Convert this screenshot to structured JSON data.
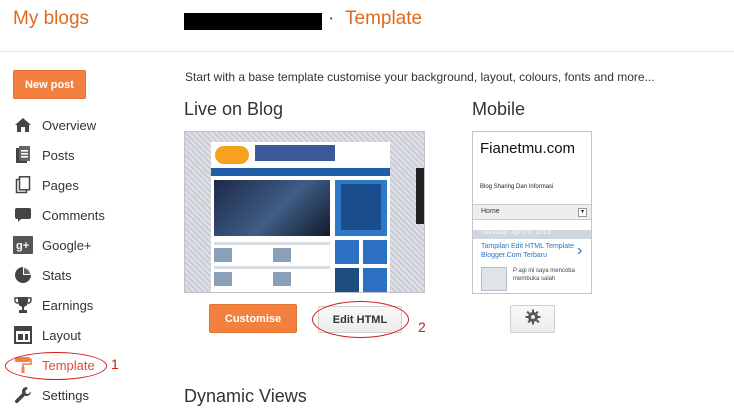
{
  "header": {
    "brand": "My blogs",
    "separator": "·",
    "page_title": "Template"
  },
  "sidebar": {
    "new_post_label": "New post",
    "items": [
      {
        "label": "Overview",
        "icon": "home-icon"
      },
      {
        "label": "Posts",
        "icon": "posts-icon"
      },
      {
        "label": "Pages",
        "icon": "pages-icon"
      },
      {
        "label": "Comments",
        "icon": "comment-icon"
      },
      {
        "label": "Google+",
        "icon": "google-plus-icon"
      },
      {
        "label": "Stats",
        "icon": "pie-chart-icon"
      },
      {
        "label": "Earnings",
        "icon": "trophy-icon"
      },
      {
        "label": "Layout",
        "icon": "layout-icon"
      },
      {
        "label": "Template",
        "icon": "paint-roller-icon",
        "active": true
      },
      {
        "label": "Settings",
        "icon": "wrench-icon"
      }
    ]
  },
  "annotations": {
    "marker_1": "1",
    "marker_2": "2",
    "color": "#d31a1a"
  },
  "main": {
    "intro_text": "Start with a base template customise your background, layout, colours, fonts and more...",
    "live_heading": "Live on Blog",
    "mobile_heading": "Mobile",
    "dynamic_heading": "Dynamic Views",
    "customise_label": "Customise",
    "edit_html_label": "Edit HTML"
  },
  "mobile_preview": {
    "site_title": "Fianetmu.com",
    "tagline": "Blog Sharing Dan Informasi",
    "menu_label": "Home",
    "date": "Tuesday, April 9, 2013",
    "post_title": "Tampilan Edit HTML Template Blogger.Com Terbaru",
    "excerpt": "P agi ini saya mencoba membuka salah"
  },
  "colors": {
    "accent": "#dd6b1f",
    "button_orange": "#f4803f",
    "active_nav": "#dd4b39",
    "link_blue": "#2877c4"
  }
}
